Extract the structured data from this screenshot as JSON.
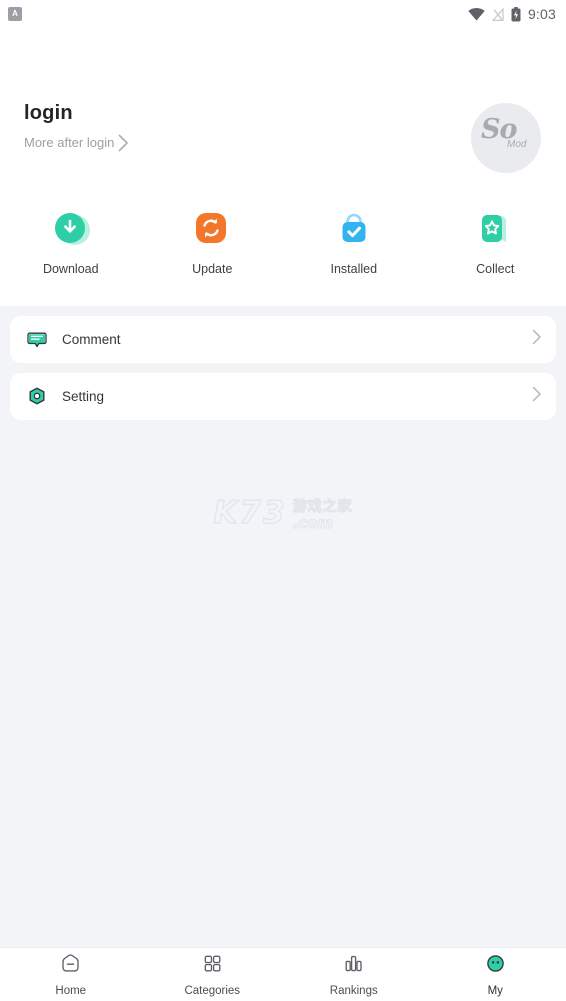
{
  "statusbar": {
    "app_badge": "A",
    "time": "9:03",
    "icons": [
      "wifi-icon",
      "signal-off-icon",
      "battery-icon"
    ]
  },
  "header": {
    "login_title": "login",
    "login_subtitle": "More after login",
    "chevron": "chevron-right-icon",
    "avatar": {
      "logo_main": "So",
      "logo_sub": "Mod"
    }
  },
  "quick_actions": [
    {
      "label": "Download",
      "icon": "download-icon",
      "color": "#2ecfa7"
    },
    {
      "label": "Update",
      "icon": "update-icon",
      "color": "#f3762a"
    },
    {
      "label": "Installed",
      "icon": "installed-bag-icon",
      "color": "#34b3f1"
    },
    {
      "label": "Collect",
      "icon": "collect-star-icon",
      "color": "#2ecfa7"
    }
  ],
  "menu_cards": [
    {
      "label": "Comment",
      "icon": "comment-icon",
      "chevron": "chevron-right-icon"
    },
    {
      "label": "Setting",
      "icon": "setting-icon",
      "chevron": "chevron-right-icon"
    }
  ],
  "watermark": {
    "brand": "K73",
    "cn": "游戏之家",
    "domain": ".com"
  },
  "bottom_nav": {
    "active": "My",
    "items": [
      {
        "label": "Home",
        "icon": "home-icon"
      },
      {
        "label": "Categories",
        "icon": "grid-icon"
      },
      {
        "label": "Rankings",
        "icon": "bar-chart-icon"
      },
      {
        "label": "My",
        "icon": "profile-avatar-icon"
      }
    ]
  },
  "colors": {
    "page_bg": "#f2f4f8",
    "card_bg": "#ffffff",
    "accent_teal": "#2ecfa7",
    "accent_orange": "#f3762a",
    "accent_blue": "#34b3f1"
  }
}
